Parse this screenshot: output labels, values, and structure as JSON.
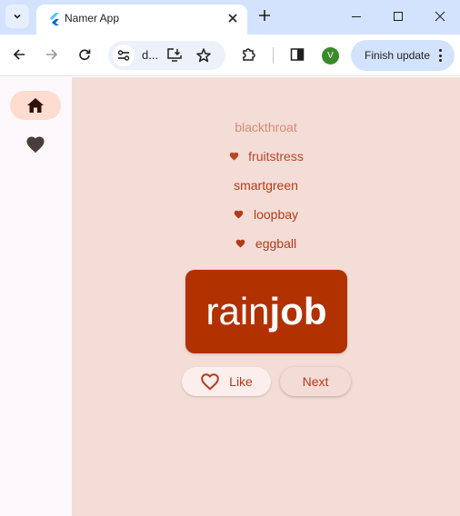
{
  "browser": {
    "tab_title": "Namer App",
    "omnibox_text": "d...",
    "profile_initial": "V",
    "finish_update_label": "Finish update"
  },
  "colors": {
    "primary": "#b13100",
    "main_bg": "#f4ddd6",
    "rail_indicator": "#ffdbd0"
  },
  "nav": {
    "items": [
      {
        "icon": "home-icon",
        "label": "Home",
        "selected": true
      },
      {
        "icon": "favorite-icon",
        "label": "Favorites",
        "selected": false
      }
    ]
  },
  "history": [
    {
      "word": "blackthroat",
      "favorite": false
    },
    {
      "word": "fruitstress",
      "favorite": true
    },
    {
      "word": "smartgreen",
      "favorite": false
    },
    {
      "word": "loopbay",
      "favorite": true
    },
    {
      "word": "eggball",
      "favorite": true
    }
  ],
  "current_pair": {
    "first": "rain",
    "second": "job"
  },
  "actions": {
    "like_label": "Like",
    "next_label": "Next"
  }
}
